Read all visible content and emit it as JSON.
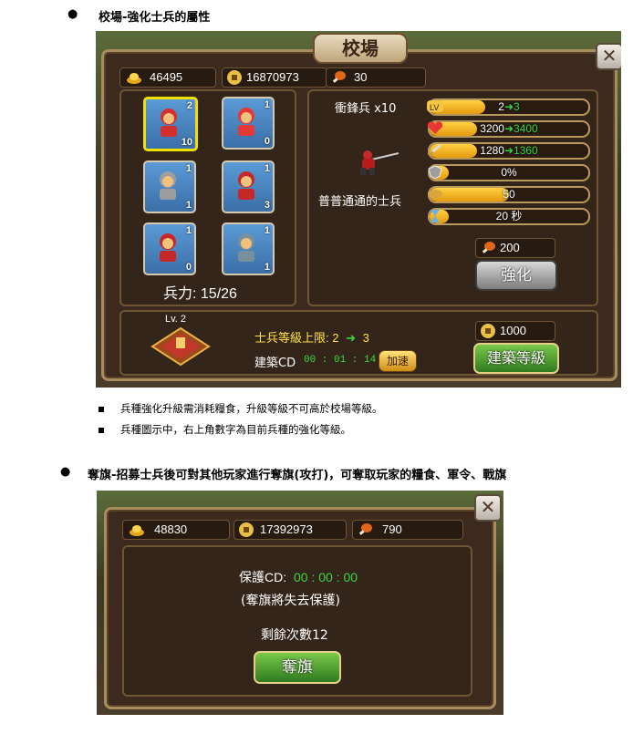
{
  "doc": {
    "heading1": "校場-強化士兵的屬性",
    "note1": "兵種強化升級需消耗糧食，升級等級不可高於校場等級。",
    "note2": "兵種圖示中，右上角數字為目前兵種的強化等級。",
    "heading2": "奪旗-招募士兵後可對其他玩家進行奪旗(攻打)，可奪取玩家的糧食、軍令、戰旗"
  },
  "barracks": {
    "title": "校場",
    "close": "✕",
    "resources": {
      "gold": "46495",
      "coins": "16870973",
      "food": "30"
    },
    "units": [
      {
        "level": "2",
        "count": "10",
        "selected": true,
        "icon": "red-helmet-soldier-icon"
      },
      {
        "level": "1",
        "count": "0",
        "icon": "chariot-soldier-icon"
      },
      {
        "level": "1",
        "count": "1",
        "icon": "armored-swordsman-icon"
      },
      {
        "level": "1",
        "count": "3",
        "icon": "spear-soldier-icon"
      },
      {
        "level": "1",
        "count": "0",
        "icon": "heavy-infantry-icon"
      },
      {
        "level": "1",
        "count": "1",
        "icon": "cavalry-icon"
      }
    ],
    "troop_label": "兵力: 15/26",
    "unit_name": "衝鋒兵 x10",
    "unit_desc": "普普通通的士兵",
    "stats": [
      {
        "icon": "level-icon",
        "icon_text": "Lv",
        "from": "2",
        "to": "3",
        "fill": 0.35
      },
      {
        "icon": "heart-icon",
        "from": "3200",
        "to": "3400",
        "fill": 0.3
      },
      {
        "icon": "sword-icon",
        "from": "1280",
        "to": "1360",
        "fill": 0.3
      },
      {
        "icon": "shield-icon",
        "value": "0%",
        "fill": 0
      },
      {
        "icon": "food-icon",
        "value": "50",
        "fill": 0.5
      },
      {
        "icon": "hourglass-icon",
        "value": "20 秒",
        "fill": 0.05
      }
    ],
    "arrow": "➜",
    "upgrade_cost": "200",
    "upgrade_button": "強化",
    "building": {
      "level": "Lv. 2",
      "cap_label": "士兵等級上限: 2",
      "cap_arrow": "➜",
      "cap_next": "3",
      "cd_label": "建築CD",
      "cd_time": "00 : 01 : 14",
      "speed_button": "加速",
      "cost": "1000",
      "upgrade_button": "建築等級"
    }
  },
  "flag": {
    "close": "✕",
    "resources": {
      "gold": "48830",
      "coins": "17392973",
      "food": "790"
    },
    "protect_label": "保護CD:",
    "protect_time": "00 : 00 : 00",
    "protect_note": "(奪旗將失去保護)",
    "remaining": "剩餘次數12",
    "button": "奪旗"
  }
}
